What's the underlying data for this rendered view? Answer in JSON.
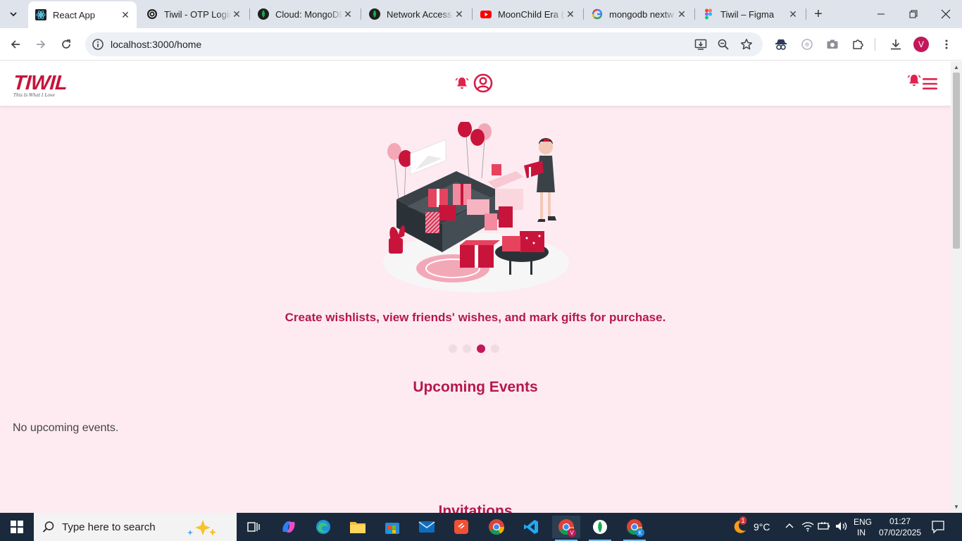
{
  "browser": {
    "tabs": [
      {
        "title": "React App",
        "active": true
      },
      {
        "title": "Tiwil - OTP Login",
        "active": false
      },
      {
        "title": "Cloud: MongoDB",
        "active": false
      },
      {
        "title": "Network Access",
        "active": false
      },
      {
        "title": "MoonChild Era (",
        "active": false
      },
      {
        "title": "mongodb nextw",
        "active": false
      },
      {
        "title": "Tiwil – Figma",
        "active": false
      }
    ],
    "url": "localhost:3000/home",
    "profile_initial": "V"
  },
  "app": {
    "logo_text": "TIWIL",
    "logo_tagline": "This Is What I Love",
    "hero_caption": "Create wishlists, view friends' wishes, and mark gifts for purchase.",
    "carousel": {
      "total": 4,
      "active_index": 2
    },
    "upcoming_title": "Upcoming Events",
    "no_events_text": "No upcoming events.",
    "invitations_title": "Invitations",
    "accent_color": "#c2185b",
    "page_bg": "#fdebf1"
  },
  "taskbar": {
    "search_placeholder": "Type here to search",
    "weather": "9°C",
    "weather_badge": "1",
    "lang_top": "ENG",
    "lang_bottom": "IN",
    "time": "01:27",
    "date": "07/02/2025",
    "chrome_profile_k": "K",
    "chrome_profile_v": "V"
  }
}
